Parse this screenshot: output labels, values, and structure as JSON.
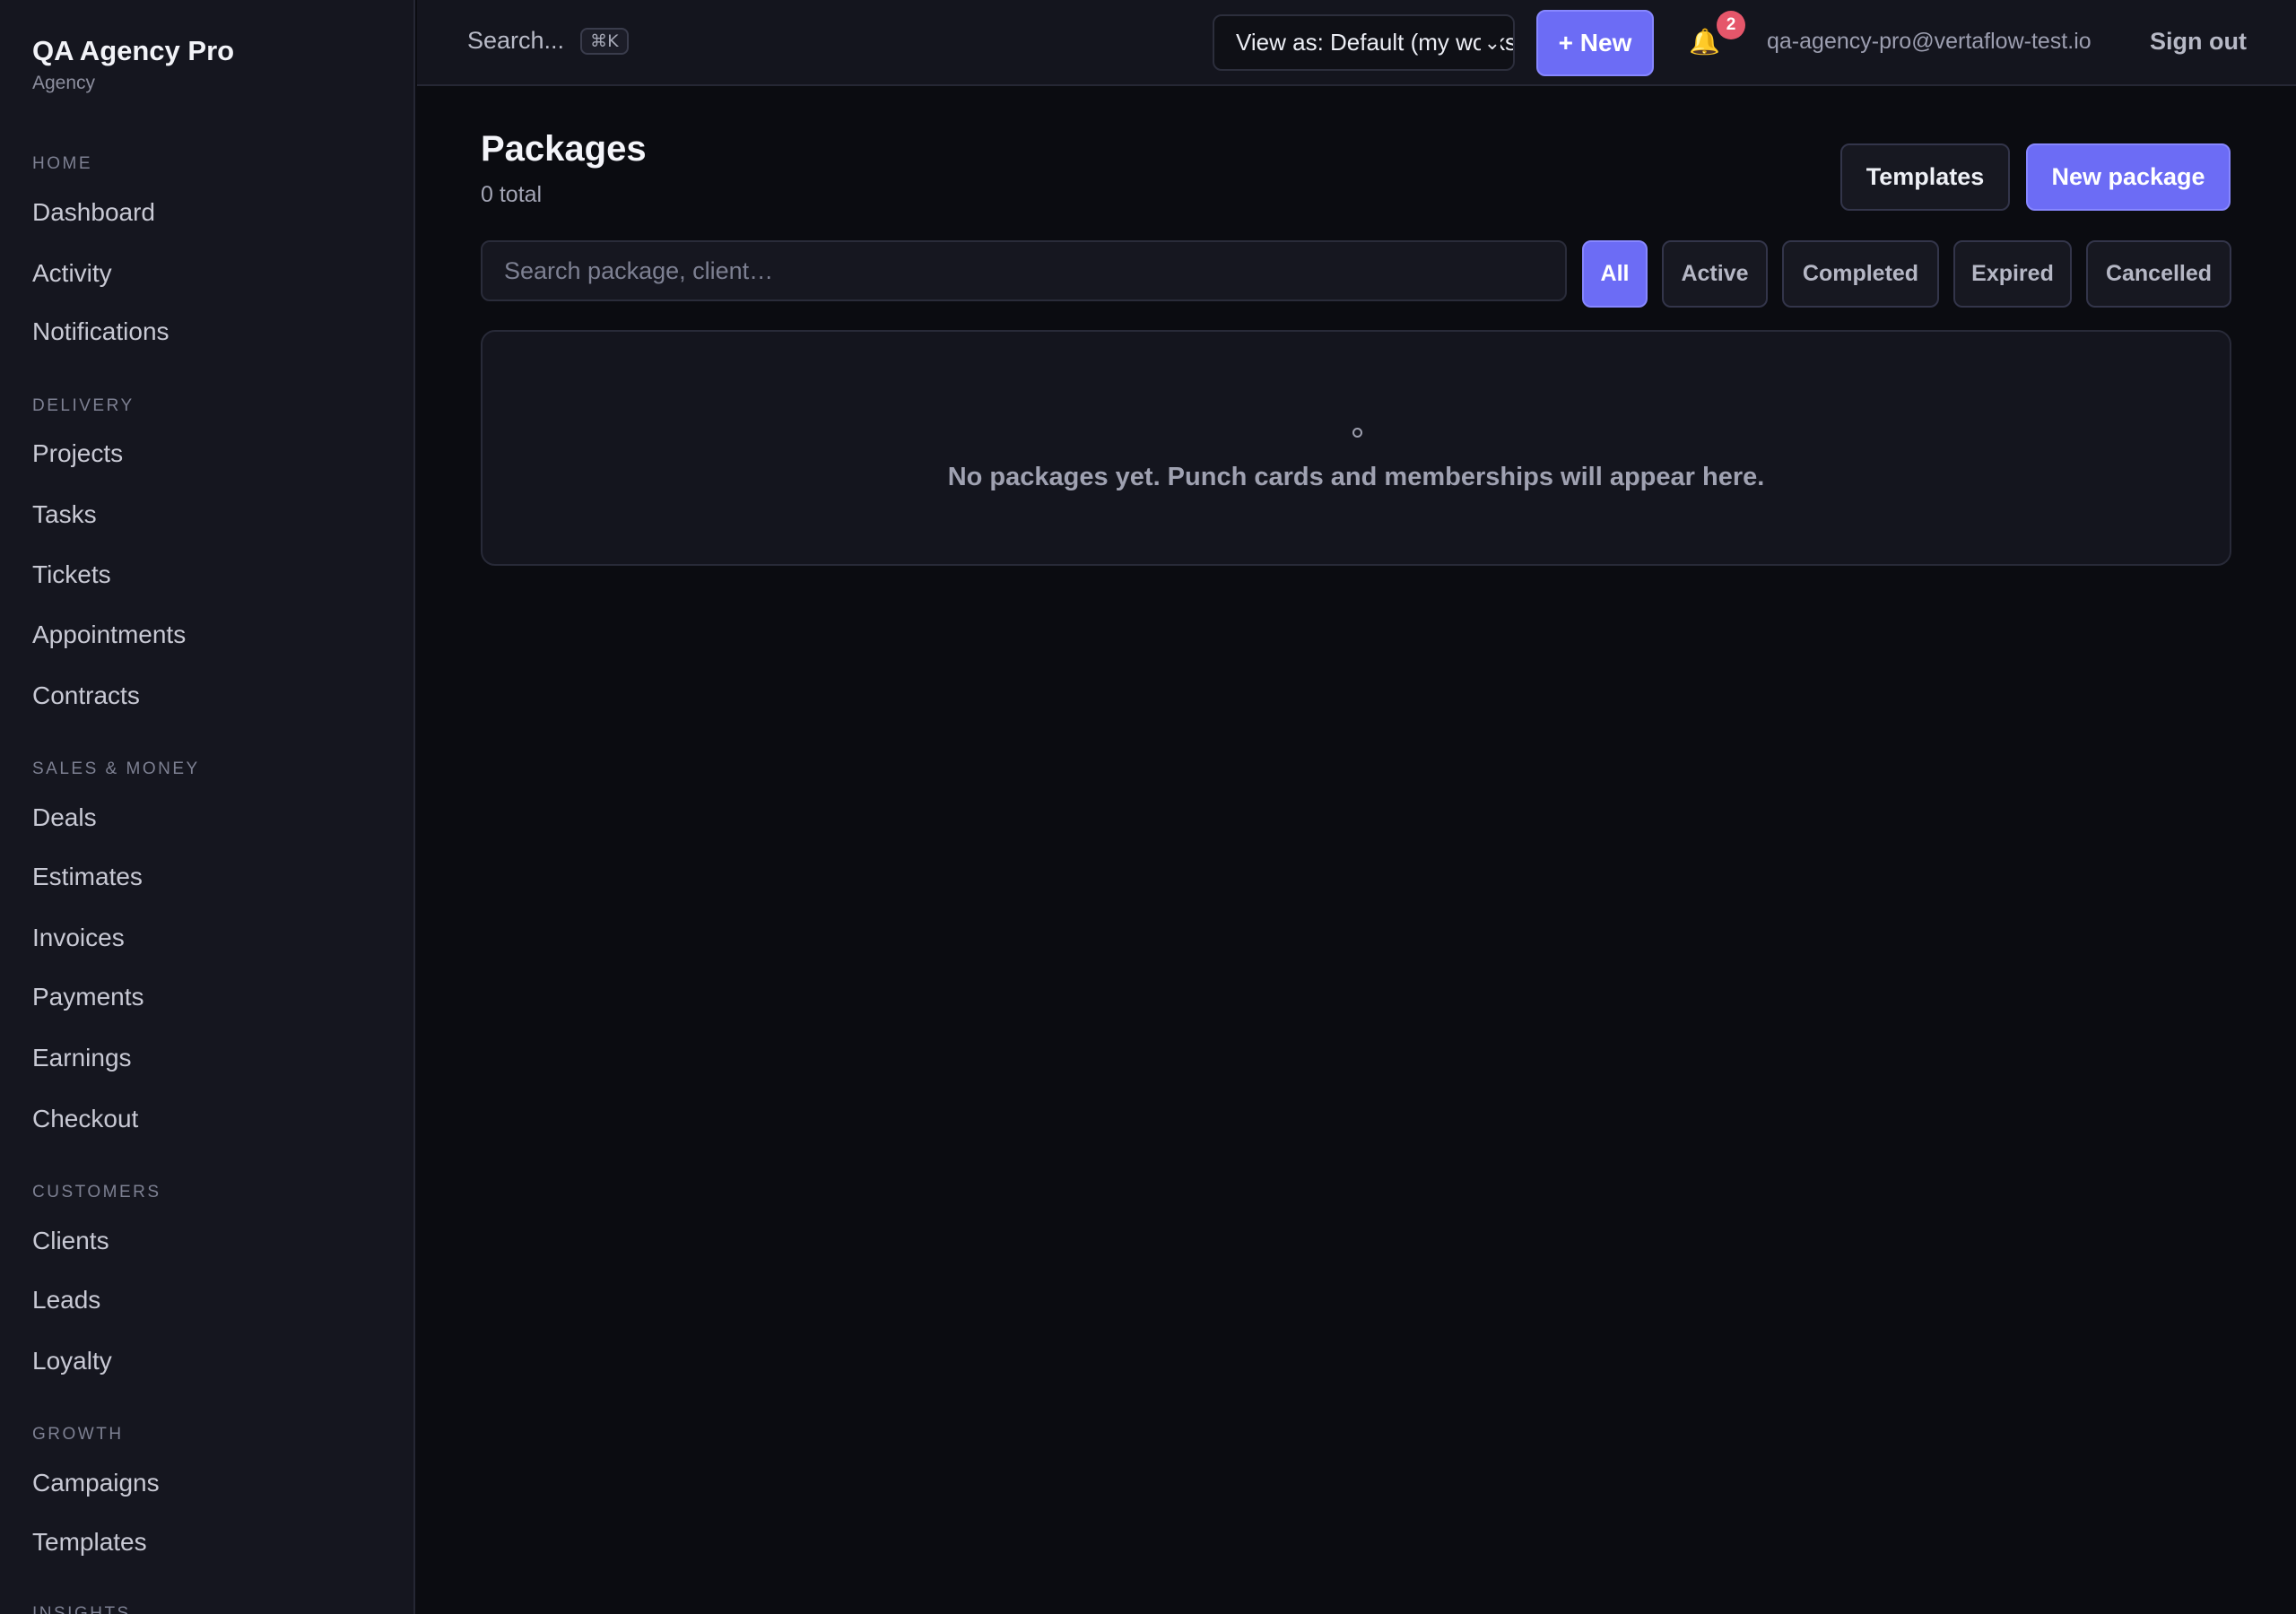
{
  "brand": {
    "title": "QA Agency Pro",
    "subtitle": "Agency"
  },
  "sidebar": {
    "sections": [
      {
        "label": "HOME",
        "items": [
          "Dashboard",
          "Activity",
          "Notifications"
        ]
      },
      {
        "label": "DELIVERY",
        "items": [
          "Projects",
          "Tasks",
          "Tickets",
          "Appointments",
          "Contracts"
        ]
      },
      {
        "label": "SALES & MONEY",
        "items": [
          "Deals",
          "Estimates",
          "Invoices",
          "Payments",
          "Earnings",
          "Checkout"
        ]
      },
      {
        "label": "CUSTOMERS",
        "items": [
          "Clients",
          "Leads",
          "Loyalty"
        ]
      },
      {
        "label": "GROWTH",
        "items": [
          "Campaigns",
          "Templates"
        ]
      },
      {
        "label": "INSIGHTS",
        "items": []
      }
    ]
  },
  "topbar": {
    "search_label": "Search...",
    "search_shortcut": "⌘K",
    "view_as": "View as: Default (my workspace)",
    "new_label": "+ New",
    "notifications_count": "2",
    "user_email": "qa-agency-pro@vertaflow-test.io",
    "sign_out": "Sign out",
    "bell_icon": "bell-icon"
  },
  "page": {
    "title": "Packages",
    "count": "0 total",
    "templates_button": "Templates",
    "new_package_button": "New package",
    "search_placeholder": "Search package, client…",
    "filters": [
      "All",
      "Active",
      "Completed",
      "Expired",
      "Cancelled"
    ],
    "active_filter": "All",
    "empty_message": "No packages yet. Punch cards and memberships will appear here."
  },
  "colors": {
    "accent": "#6c6cf5",
    "background": "#0b0c11",
    "sidebar": "#15161f",
    "badge": "#e5566a"
  }
}
